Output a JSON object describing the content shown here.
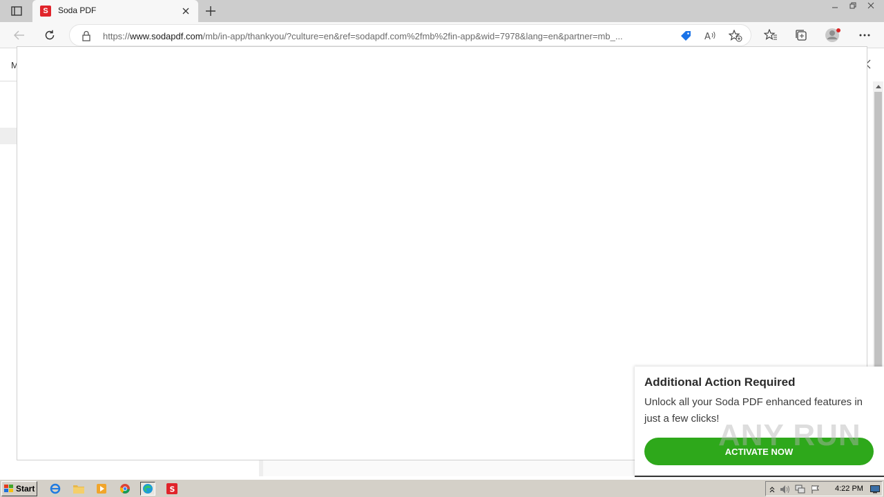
{
  "browser": {
    "tab": {
      "favicon_letter": "S",
      "title": "Soda PDF",
      "favicon_color": "#e0242b"
    },
    "address": {
      "scheme": "https://",
      "host": "www.sodapdf.com",
      "path": "/mb/in-app/thankyou/?culture=en&ref=sodapdf.com%2fmb%2fin-app&wid=7978&lang=en&partner=mb_..."
    },
    "icons": {
      "tab_actions": "tab-actions-icon",
      "new_tab": "plus-icon",
      "back": "back-arrow-icon",
      "refresh": "refresh-icon",
      "lock": "lock-icon",
      "coupon": "price-tag-icon",
      "read_aloud": "read-aloud-icon",
      "add_favorite": "star-plus-icon",
      "favorites": "favorites-icon",
      "collections": "collections-icon",
      "profile": "profile-avatar-icon",
      "more": "more-dots-icon"
    }
  },
  "page": {
    "left_letter": "M"
  },
  "notification": {
    "title": "Additional Action Required",
    "body": "Unlock all your Soda PDF enhanced features in just a few clicks!",
    "button_label": "ACTIVATE NOW",
    "button_color": "#2ea81b"
  },
  "watermark": "ANY RUN",
  "taskbar": {
    "start_label": "Start",
    "clock": "4:22 PM"
  }
}
